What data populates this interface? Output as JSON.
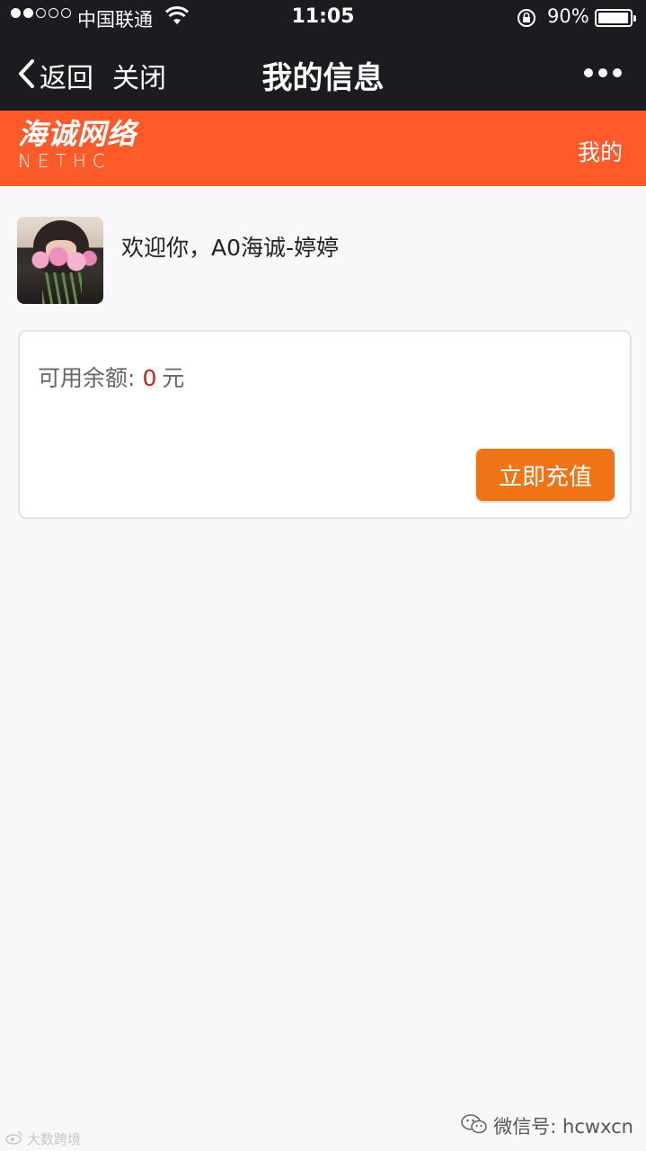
{
  "status_bar": {
    "carrier": "中国联通",
    "time": "11:05",
    "battery_percent": "90%",
    "battery_level": 0.9
  },
  "nav": {
    "back_label": "返回",
    "close_label": "关闭",
    "title": "我的信息"
  },
  "brand": {
    "logo_cn": "海诚网络",
    "logo_en": "NETHC",
    "mine_link": "我的",
    "color": "#ff5b2a"
  },
  "user": {
    "welcome": "欢迎你，A0海诚-婷婷"
  },
  "balance": {
    "label": "可用余额:",
    "value": "0",
    "unit": "元",
    "recharge_button": "立即充值",
    "button_color": "#f07315"
  },
  "watermark": {
    "left": "大数跨境",
    "right": "微信号: hcwxcn"
  }
}
